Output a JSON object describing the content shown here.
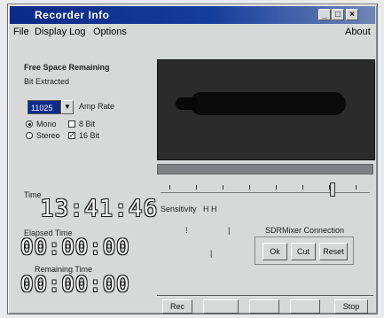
{
  "window": {
    "title": "Recorder Info",
    "controls": {
      "minimize": "_",
      "maximize": "□",
      "close": "×"
    }
  },
  "menu": {
    "items": [
      "File",
      "Display Log",
      "Options"
    ],
    "right": "About"
  },
  "left_panel": {
    "heading": "Free Space Remaining",
    "sub_heading": "Bit Extracted",
    "combo_value": "11025",
    "rate_label": "Amp Rate",
    "radio_rows": [
      {
        "a": "Mono",
        "b": "8 Bit"
      },
      {
        "a": "Stereo",
        "b": "16 Bit"
      }
    ],
    "time_label": "Time",
    "time_value": "13:41:46",
    "elapsed_label": "Elapsed Time",
    "elapsed_value": "00:00:00",
    "remaining_label": "Remaining Time",
    "remaining_value": "00:00:00"
  },
  "right_panel": {
    "sensitivity_label": "Sensitivity",
    "sensitivity_value": "H  H",
    "group_label": "SDRMixer Connection",
    "group_buttons": [
      "Ok",
      "Cut",
      "Reset"
    ],
    "bottom_buttons": [
      "Rec",
      "",
      "",
      "",
      "Stop"
    ],
    "slider_position": 0.82
  }
}
